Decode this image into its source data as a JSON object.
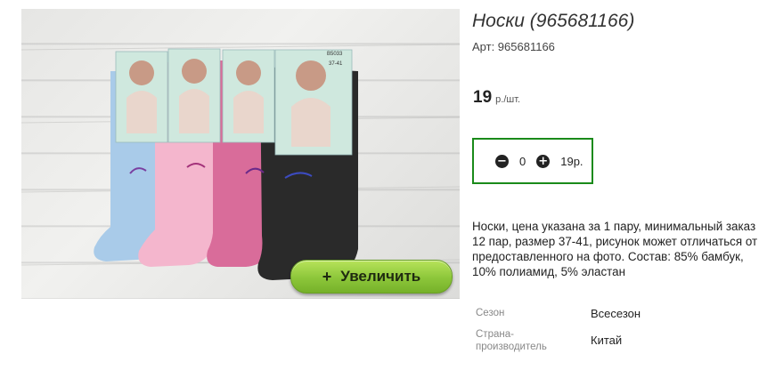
{
  "product": {
    "title": "Носки (965681166)",
    "sku": "Арт: 965681166",
    "price_value": "19",
    "price_unit": "р./шт.",
    "description": "Носки, цена указана за 1 пару, минимальный заказ 12 пар, размер 37-41, рисунок может отличаться от предоставленного на фото. Состав: 85% бамбук, 10% полиамид, 5% эластан"
  },
  "gallery": {
    "zoom_icon": "+",
    "zoom_label": "Увеличить",
    "package_code": "B5033",
    "package_size": "37-41",
    "sock_colors": [
      "#a9cbe9",
      "#f4b6cd",
      "#d96c9a",
      "#2a2a2a"
    ]
  },
  "cart": {
    "minus_icon": "−",
    "plus_icon": "+",
    "quantity": "0",
    "total": "19р."
  },
  "attributes": [
    {
      "label": "Сезон",
      "value": "Всесезон"
    },
    {
      "label": "Страна-производитель",
      "value": "Китай"
    }
  ],
  "colors": {
    "accent_border": "#1a8a1a",
    "button_green": "#8cc63a"
  }
}
